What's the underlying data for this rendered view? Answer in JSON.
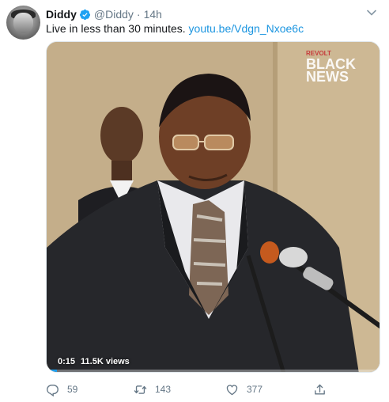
{
  "tweet": {
    "display_name": "Diddy",
    "verified": true,
    "handle": "@Diddy",
    "separator": "·",
    "time": "14h",
    "text": "Live in less than 30 minutes.",
    "link": "youtu.be/Vdgn_Nxoe6c"
  },
  "media": {
    "watermark_line1": "REVOLT",
    "watermark_line2": "BLACK",
    "watermark_line3": "NEWS",
    "time_elapsed": "0:15",
    "views": "11.5K views",
    "progress_fraction": 0.03
  },
  "actions": {
    "reply_count": "59",
    "retweet_count": "143",
    "like_count": "377"
  },
  "colors": {
    "accent": "#1da1f2",
    "link": "#1b95e0",
    "muted": "#657786",
    "retweet_icon": "#17bf63"
  },
  "icons": [
    "verified-badge-icon",
    "chevron-down-icon",
    "reply-icon",
    "retweet-icon",
    "like-icon",
    "share-icon"
  ]
}
